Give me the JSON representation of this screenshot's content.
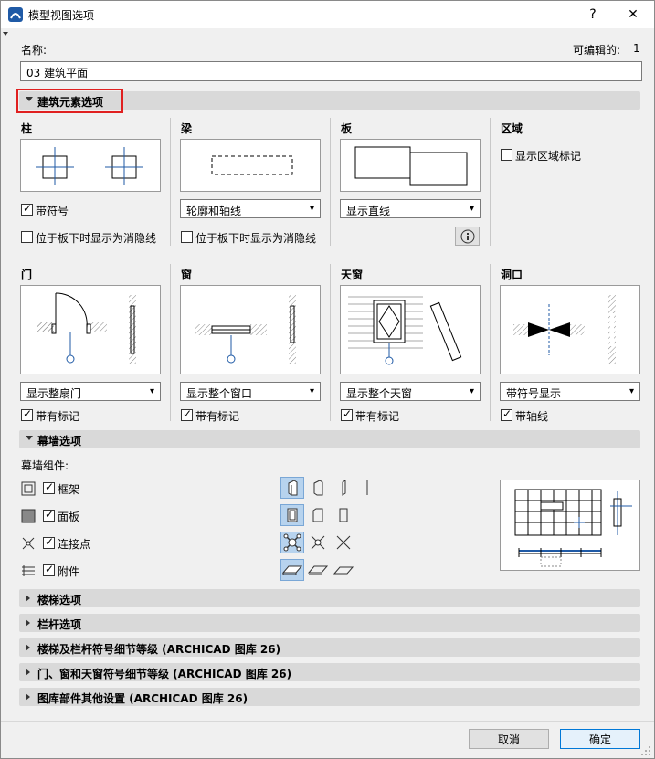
{
  "window": {
    "title": "模型视图选项",
    "help": "?",
    "close": "✕"
  },
  "name_field": {
    "label": "名称:",
    "value": "03 建筑平面",
    "editable_label": "可编辑的:",
    "editable_value": "1"
  },
  "section_elements": {
    "label": "建筑元素选项"
  },
  "column": {
    "title": "柱",
    "show_symbol": "带符号",
    "hidden_under_slab": "位于板下时显示为消隐线"
  },
  "beam": {
    "title": "梁",
    "select_value": "轮廓和轴线",
    "hidden_under_slab": "位于板下时显示为消隐线"
  },
  "slab": {
    "title": "板",
    "select_value": "显示直线"
  },
  "zone": {
    "title": "区域",
    "show_stamp": "显示区域标记"
  },
  "door": {
    "title": "门",
    "select_value": "显示整扇门",
    "with_marker": "带有标记"
  },
  "window_opt": {
    "title": "窗",
    "select_value": "显示整个窗口",
    "with_marker": "带有标记"
  },
  "skylight": {
    "title": "天窗",
    "select_value": "显示整个天窗",
    "with_marker": "带有标记"
  },
  "opening": {
    "title": "洞口",
    "select_value": "带符号显示",
    "with_axis": "带轴线"
  },
  "section_curtain": {
    "label": "幕墙选项"
  },
  "curtain": {
    "components_label": "幕墙组件:",
    "frame": "框架",
    "panel": "面板",
    "junction": "连接点",
    "accessory": "附件"
  },
  "sections_collapsed": [
    "楼梯选项",
    "栏杆选项",
    "楼梯及栏杆符号细节等级 (ARCHICAD 图库 26)",
    "门、窗和天窗符号细节等级 (ARCHICAD 图库 26)",
    "图库部件其他设置 (ARCHICAD 图库 26)"
  ],
  "footer": {
    "cancel": "取消",
    "ok": "确定"
  },
  "colors": {
    "highlight": "#e02020",
    "active": "#b7d3ee",
    "accent": "#0078d7"
  }
}
